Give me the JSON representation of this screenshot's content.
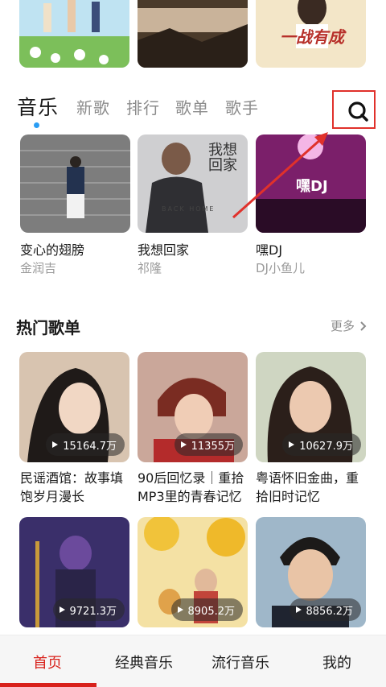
{
  "tabs": [
    {
      "label": "音乐",
      "active": true
    },
    {
      "label": "新歌",
      "active": false
    },
    {
      "label": "排行",
      "active": false
    },
    {
      "label": "歌单",
      "active": false
    },
    {
      "label": "歌手",
      "active": false
    }
  ],
  "banners": [
    {
      "caption": ""
    },
    {
      "caption": ""
    },
    {
      "caption": "一战有成"
    }
  ],
  "songs": [
    {
      "title": "变心的翅膀",
      "artist": "金润吉"
    },
    {
      "title": "我想回家",
      "artist": "祁隆",
      "cover_text": "我想回家",
      "cover_sub": "BACK HOME"
    },
    {
      "title": "嘿DJ",
      "artist": "DJ小鱼儿",
      "cover_text": "嘿DJ"
    }
  ],
  "section": {
    "title": "热门歌单",
    "more": "更多"
  },
  "playlists": [
    {
      "title": "民谣酒馆：故事填饱岁月漫长",
      "plays": "15164.7万"
    },
    {
      "title": "90后回忆录｜重拾MP3里的青春记忆",
      "plays": "11355万"
    },
    {
      "title": "粤语怀旧金曲，重拾旧时记忆",
      "plays": "10627.9万"
    },
    {
      "title": "",
      "plays": "9721.3万"
    },
    {
      "title": "",
      "plays": "8905.2万"
    },
    {
      "title": "",
      "plays": "8856.2万"
    }
  ],
  "bottom_nav": [
    {
      "label": "首页",
      "active": true
    },
    {
      "label": "经典音乐",
      "active": false
    },
    {
      "label": "流行音乐",
      "active": false
    },
    {
      "label": "我的",
      "active": false
    }
  ],
  "colors": {
    "accent": "#d8211b",
    "dot": "#2a9df4",
    "annotation": "#e0312b"
  },
  "icons": {
    "search": "search-icon",
    "more": "chevron-right-icon",
    "play": "play-icon"
  }
}
